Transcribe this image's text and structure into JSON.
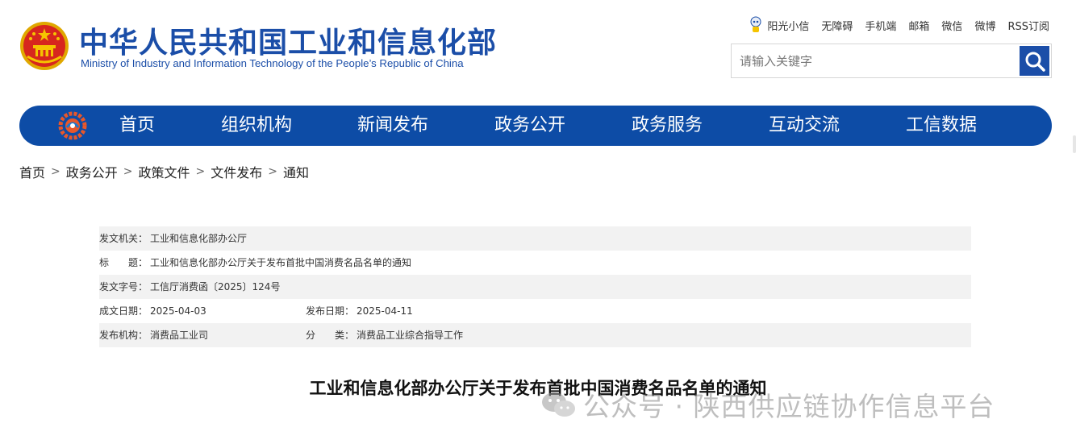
{
  "header": {
    "title": "中华人民共和国工业和信息化部",
    "subtitle": "Ministry of Industry and Information Technology of the People’s Republic of China"
  },
  "toplinks": [
    "阳光小信",
    "无障碍",
    "手机端",
    "邮箱",
    "微信",
    "微博",
    "RSS订阅"
  ],
  "search": {
    "placeholder": "请输入关键字"
  },
  "nav": [
    "首页",
    "组织机构",
    "新闻发布",
    "政务公开",
    "政务服务",
    "互动交流",
    "工信数据"
  ],
  "breadcrumb": [
    "首页",
    "政务公开",
    "政策文件",
    "文件发布",
    "通知"
  ],
  "breadcrumb_sep": ">",
  "info": {
    "issuer_label": "发文机关：",
    "issuer": "工业和信息化部办公厅",
    "title_label": "标　　题：",
    "title": "工业和信息化部办公厅关于发布首批中国消费名品名单的通知",
    "docno_label": "发文字号：",
    "docno": "工信厅消费函〔2025〕124号",
    "created_label": "成文日期：",
    "created": "2025-04-03",
    "published_label": "发布日期：",
    "published": "2025-04-11",
    "org_label": "发布机构：",
    "org": "消费品工业司",
    "category_label": "分　　类：",
    "category": "消费品工业综合指导工作"
  },
  "doc_title": "工业和信息化部办公厅关于发布首批中国消费名品名单的通知",
  "watermark": "公众号 · 陕西供应链协作信息平台",
  "colors": {
    "brand_blue": "#1b4ea8",
    "nav_blue": "#0d4ca6",
    "emblem_red": "#d7261e",
    "emblem_gold": "#f5c400"
  }
}
